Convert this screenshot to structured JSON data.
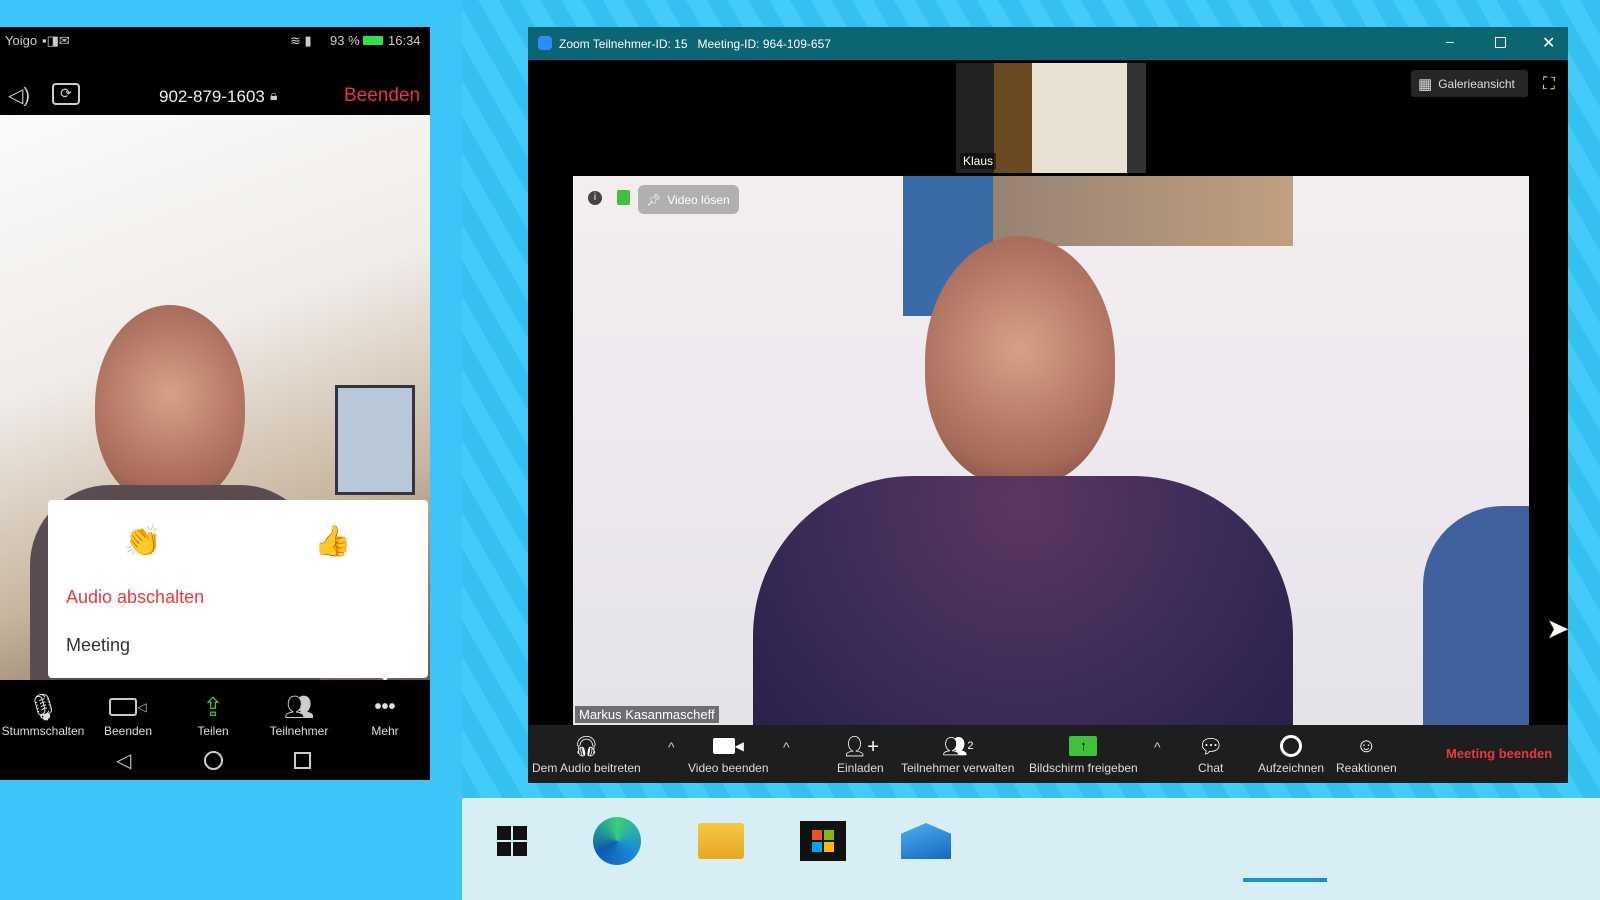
{
  "phone": {
    "status": {
      "carrier": "Yoigo",
      "battery": "93 %",
      "time": "16:34"
    },
    "header": {
      "meeting_number": "902-879-1603",
      "end_label": "Beenden"
    },
    "popup": {
      "reactions": [
        "clap",
        "thumbs-up"
      ],
      "audio_off": "Audio abschalten",
      "meeting": "Meeting"
    },
    "toolbar": [
      {
        "label": "Stummschalten",
        "icon": "microphone-icon"
      },
      {
        "label": "Beenden",
        "icon": "video-camera-icon"
      },
      {
        "label": "Teilen",
        "icon": "share-icon"
      },
      {
        "label": "Teilnehmer",
        "icon": "participants-icon"
      },
      {
        "label": "Mehr",
        "icon": "more-icon"
      }
    ]
  },
  "zoom": {
    "title": "Zoom Teilnehmer-ID: 15   Meeting-ID: 964-109-657",
    "gallery_view": "Galerieansicht",
    "thumbnail_name": "Klaus",
    "unpin_label": "Video lösen",
    "speaker_name": "Markus Kasanmascheff",
    "participant_count": "2",
    "toolbar": {
      "audio": "Dem Audio beitreten",
      "video": "Video beenden",
      "invite": "Einladen",
      "participants": "Teilnehmer verwalten",
      "share": "Bildschirm freigeben",
      "chat": "Chat",
      "record": "Aufzeichnen",
      "reactions": "Reaktionen",
      "end": "Meeting beenden"
    },
    "colors": {
      "titlebar": "#0c6573",
      "end": "#e8383d",
      "share": "#3fc23a"
    }
  },
  "taskbar": {
    "items": [
      "windows-start",
      "edge",
      "file-explorer",
      "store",
      "mail"
    ],
    "active": "file-explorer"
  }
}
